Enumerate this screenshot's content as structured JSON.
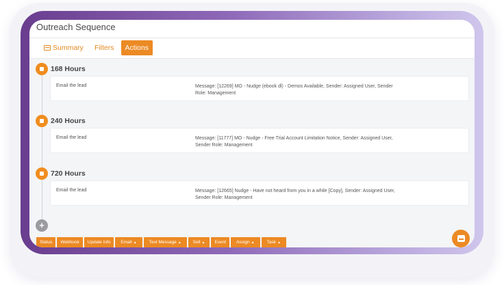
{
  "window": {
    "title": "Outreach Sequence"
  },
  "tabs": [
    {
      "label": "Summary",
      "icon": "summary-icon",
      "active": false
    },
    {
      "label": "Filters",
      "active": false
    },
    {
      "label": "Actions",
      "active": true
    }
  ],
  "steps": [
    {
      "delay": "168 Hours",
      "action": "Email the lead",
      "message": "Message: [12269] MO - Nudge (ebook dl) - Demos Available, Sender: Assigned User, Sender Role: Management"
    },
    {
      "delay": "240 Hours",
      "action": "Email the lead",
      "message": "Message: [11777] MO - Nudge - Free Trial Account Limitation Notice, Sender: Assigned User, Sender Role: Management"
    },
    {
      "delay": "720 Hours",
      "action": "Email the lead",
      "message": "Message: [12665] Nudge - Have not heard from you in a while [Copy], Sender: Assigned User, Sender Role: Management"
    }
  ],
  "add_step": {
    "label": "+"
  },
  "action_buttons": [
    {
      "label": "Status",
      "dropdown": false
    },
    {
      "label": "Webhook",
      "dropdown": false
    },
    {
      "label": "Update Info",
      "dropdown": false
    },
    {
      "label": "Email",
      "dropdown": true
    },
    {
      "label": "Text Message",
      "dropdown": true
    },
    {
      "label": "Sell",
      "dropdown": true
    },
    {
      "label": "Event",
      "dropdown": false
    },
    {
      "label": "Assign",
      "dropdown": true
    },
    {
      "label": "Task",
      "dropdown": true
    }
  ],
  "colors": {
    "accent": "#ec8a24",
    "frame_start": "#6a3d8f",
    "frame_end": "#cfc6ec"
  }
}
